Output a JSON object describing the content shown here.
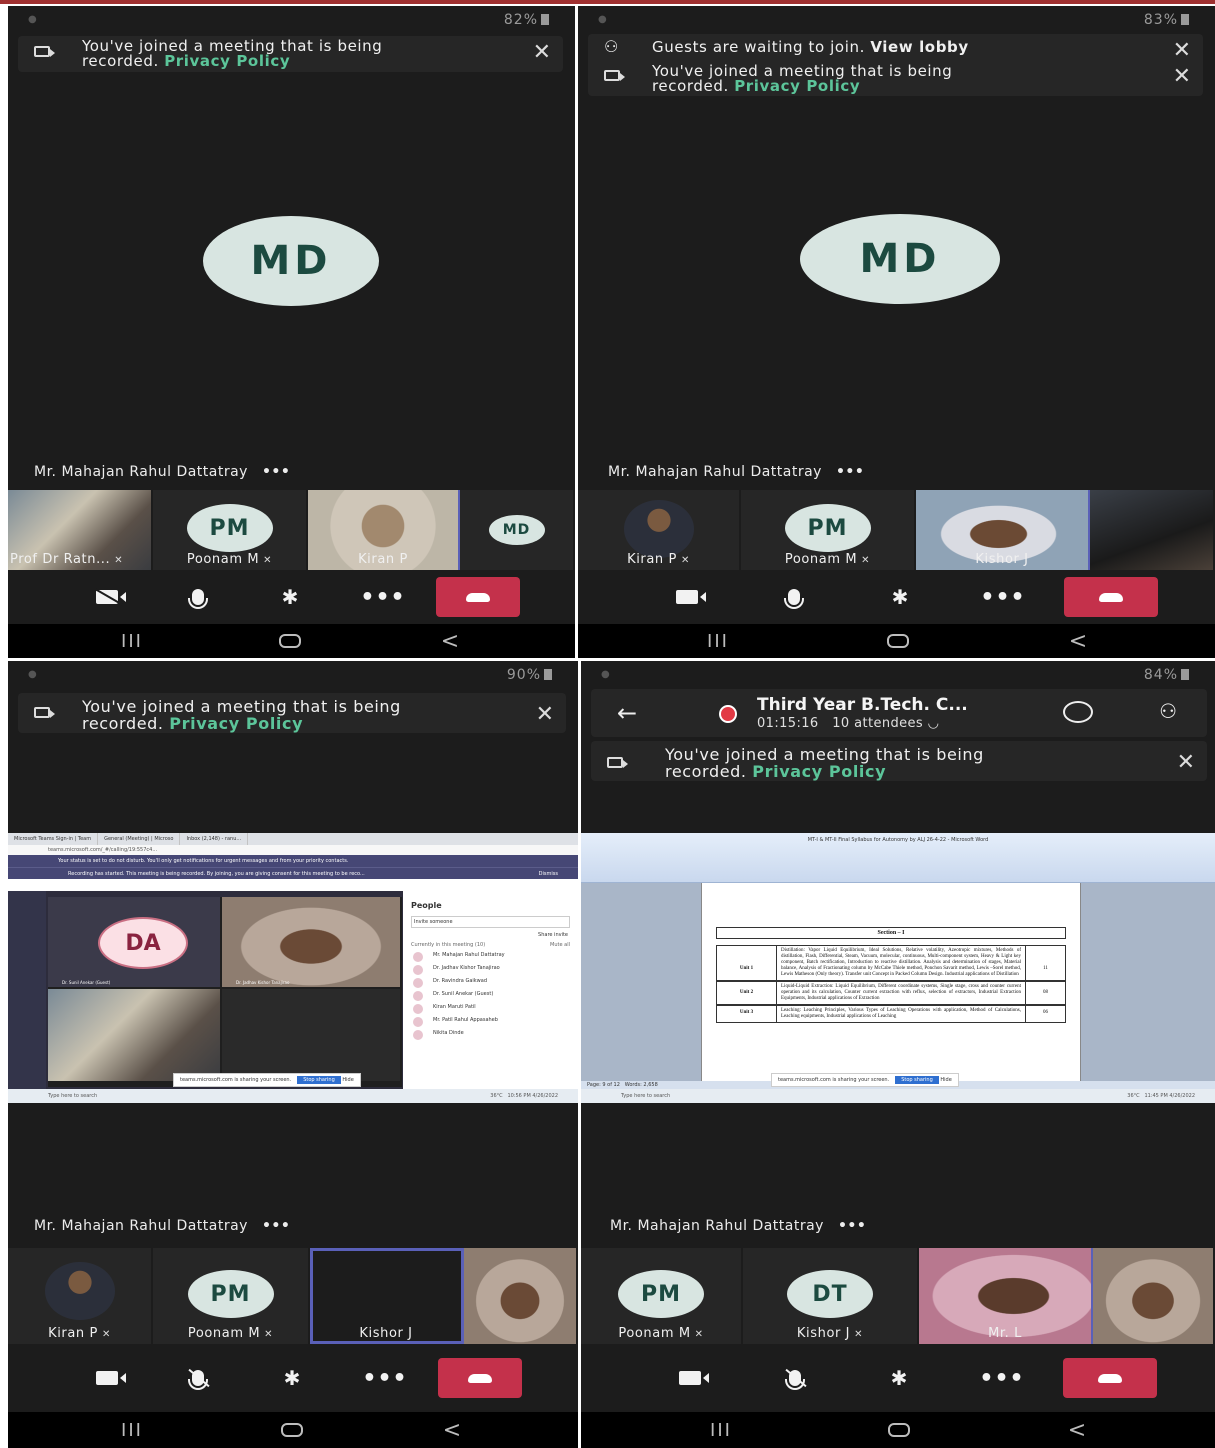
{
  "common": {
    "recording_text": "You've joined a meeting that is being",
    "recording_text_2": "recorded.",
    "privacy_link": "Privacy Policy",
    "close_glyph": "✕",
    "speaker_name": "Mr. Mahajan Rahul Dattatray",
    "more_dots": "•••",
    "nav_recent": "III",
    "nav_back": "<",
    "mute_glyph": "✕",
    "bluetooth_glyph": "✱",
    "accent_link_color": "#5cc59a",
    "hangup_color": "#c4314b"
  },
  "panel1": {
    "battery": "82%",
    "speaker_initials": "MD",
    "tiles": [
      {
        "name": "Prof Dr Ratn...",
        "muted": true
      },
      {
        "initials": "PM",
        "name": "Poonam M",
        "muted": true
      },
      {
        "name": "Kiran P",
        "muted": false
      },
      {
        "initials": "MD",
        "name": "",
        "muted": false
      }
    ]
  },
  "panel2": {
    "battery": "83%",
    "guests_text": "Guests are waiting to join.",
    "view_lobby": "View lobby",
    "speaker_initials": "MD",
    "tiles": [
      {
        "name": "Kiran P",
        "muted": true
      },
      {
        "initials": "PM",
        "name": "Poonam M",
        "muted": true
      },
      {
        "name": "Kishor J",
        "muted": false
      },
      {
        "name": "",
        "muted": false
      }
    ]
  },
  "panel3": {
    "battery": "90%",
    "shared_screen": {
      "tabs": [
        "Microsoft Teams Sign-in | Team",
        "General (Meeting) | Microso",
        "Inbox (2,148) - ranu..."
      ],
      "address": "teams.microsoft.com/_#/calling/19:557c4...",
      "status_msg": "Your status is set to do not disturb. You'll only get notifications for urgent messages and from your priority contacts.",
      "recording_msg": "Recording has started. This meeting is being recorded. By joining, you are giving consent for this meeting to be reco...",
      "dismiss": "Dismiss",
      "stage_avatar": "DA",
      "stage_caption_1": "Dr. Sunil Anekar (Guest)",
      "stage_caption_2": "Dr. Jadhav Kishor Tanajirao",
      "people_title": "People",
      "invite_placeholder": "Invite someone",
      "share_invite": "Share invite",
      "currently_in": "Currently in this meeting (10)",
      "mute_all": "Mute all",
      "people": [
        "Mr. Mahajan Rahul Dattatray",
        "Dr. Jadhav Kishor Tanajirao",
        "Dr. Ravindra Gaikwad",
        "Dr. Sunil Anekar (Guest)",
        "Kiran Maruti Patil",
        "Mr. Patil Rahul Appasaheb",
        "Nikita Dinde"
      ],
      "sharing_msg": "teams.microsoft.com is sharing your screen.",
      "stop_sharing": "Stop sharing",
      "hide": "Hide",
      "search_placeholder": "Type here to search",
      "clock": "10:56 PM",
      "date": "4/26/2022",
      "temp": "36°C"
    },
    "tiles": [
      {
        "name": "Kiran P",
        "muted": true
      },
      {
        "initials": "PM",
        "name": "Poonam M",
        "muted": true
      },
      {
        "name": "Kishor J",
        "muted": false
      },
      {
        "name": "",
        "muted": false
      }
    ]
  },
  "panel4": {
    "battery": "84%",
    "meeting_title": "Third Year B.Tech. C...",
    "duration": "01:15:16",
    "attendees": "10 attendees",
    "shared_doc": {
      "window_title": "MT-I & MT-II Final Syllabus for Autonomy by ALJ 26-4-22 - Microsoft Word",
      "section_heading": "Section – I",
      "units": [
        {
          "unit": "Unit 1",
          "text": "Distillation: Vapor Liquid Equilibrium, Ideal Solutions, Relative volatility, Azeotropic mixtures, Methods of distillation, Flash, Differential, Steam, Vacuum, molecular, continuous, Multi-component system, Heavy & Light key component, Batch rectification, Introduction to reactive distillation. Analysis and determination of stages, Material balance, Analysis of Fractionating column by McCabe Thiele method, Ponchon Savarit method, Lewis –Sorel method, Lewis Matheson (Only theory). Transfer unit Concept in Packed Column Design. Industrial applications of Distillation",
          "hours": "11"
        },
        {
          "unit": "Unit 2",
          "text": "Liquid-Liquid Extraction: Liquid Equilibrium, Different coordinate systems, Single stage, cross and counter current operation and its calculation, Counter current extraction with reflux, selection of extractors, Industrial Extraction Equipments, Industrial applications of Extraction",
          "hours": "08"
        },
        {
          "unit": "Unit 3",
          "text": "Leaching: Leaching Principles, Various Types of Leaching Operations with application, Method of Calculations, Leaching equipments, Industrial applications of Leaching",
          "hours": "06"
        }
      ],
      "sharing_msg": "teams.microsoft.com is sharing your screen.",
      "stop_sharing": "Stop sharing",
      "hide": "Hide",
      "search_placeholder": "Type here to search",
      "clock": "11:45 PM",
      "date": "4/26/2022",
      "temp": "36°C",
      "page_info": "Page: 9 of 12",
      "words": "Words: 2,658"
    },
    "tiles": [
      {
        "initials": "PM",
        "name": "Poonam M",
        "muted": true
      },
      {
        "initials": "DT",
        "name": "Kishor J",
        "muted": true
      },
      {
        "name": "Mr. L",
        "muted": false
      },
      {
        "name": "",
        "muted": false
      }
    ]
  }
}
